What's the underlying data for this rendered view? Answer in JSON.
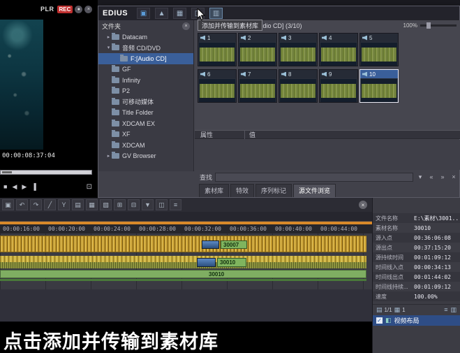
{
  "monitor": {
    "plr_label": "PLR",
    "rec_label": "REC",
    "timecode": "00:00:08:37:04",
    "buttons": [
      {
        "name": "monitor-menu-button",
        "glyph": "●"
      },
      {
        "name": "monitor-close-button",
        "glyph": "×"
      }
    ],
    "transport": [
      {
        "name": "stop-button",
        "glyph": "■"
      },
      {
        "name": "prev-frame-button",
        "glyph": "◀"
      },
      {
        "name": "play-button",
        "glyph": "▶"
      },
      {
        "name": "next-frame-button",
        "glyph": "▐"
      }
    ],
    "fullscreen_glyph": "⊡"
  },
  "browser": {
    "app_title": "EDIUS",
    "titlebar_icons": [
      {
        "name": "open-folder-icon",
        "glyph": "▣"
      },
      {
        "name": "up-folder-icon",
        "glyph": "▲"
      },
      {
        "name": "view-thumbnails-icon",
        "glyph": "▦"
      },
      {
        "name": "view-split-icon",
        "glyph": "◫"
      },
      {
        "name": "add-transfer-icon",
        "glyph": "▥"
      }
    ],
    "tooltip": "添加并传输到素材库",
    "folders_header": "文件夹",
    "folders_close_glyph": "×",
    "tree": [
      {
        "label": "Datacam",
        "expander": "▸"
      },
      {
        "label": "音频 CD/DVD",
        "expander": "▾"
      },
      {
        "label": "F:[Audio CD]",
        "expander": ""
      },
      {
        "label": "GF",
        "expander": ""
      },
      {
        "label": "Infinity",
        "expander": ""
      },
      {
        "label": "P2",
        "expander": ""
      },
      {
        "label": "可移动媒体",
        "expander": ""
      },
      {
        "label": "Title Folder",
        "expander": ""
      },
      {
        "label": "XDCAM EX",
        "expander": ""
      },
      {
        "label": "XF",
        "expander": ""
      },
      {
        "label": "XDCAM",
        "expander": ""
      },
      {
        "label": "GV Browser",
        "expander": "▸"
      }
    ],
    "clips_title": "F:[Audio CD]  (3/10)",
    "zoom_label": "100%",
    "clips": [
      {
        "num": "1"
      },
      {
        "num": "2"
      },
      {
        "num": "3"
      },
      {
        "num": "4"
      },
      {
        "num": "5"
      },
      {
        "num": "6"
      },
      {
        "num": "7"
      },
      {
        "num": "8"
      },
      {
        "num": "9"
      },
      {
        "num": "10"
      }
    ],
    "props_name_col": "属性",
    "props_value_col": "值",
    "search_label": "查找",
    "search_icons": [
      {
        "name": "search-dropdown-icon",
        "glyph": "▾"
      },
      {
        "name": "prev-result-icon",
        "glyph": "«"
      },
      {
        "name": "next-result-icon",
        "glyph": "»"
      },
      {
        "name": "close-search-icon",
        "glyph": "×"
      }
    ],
    "tabs": [
      {
        "label": "素材库"
      },
      {
        "label": "特效"
      },
      {
        "label": "序列标记"
      },
      {
        "label": "源文件浏览"
      }
    ]
  },
  "timeline": {
    "toolbar": [
      {
        "name": "panel-icon",
        "glyph": "▣"
      },
      {
        "name": "undo-icon",
        "glyph": "↶"
      },
      {
        "name": "redo-icon",
        "glyph": "↷"
      },
      {
        "name": "pencil-icon",
        "glyph": "╱"
      },
      {
        "name": "razor-icon",
        "glyph": "Y"
      },
      {
        "name": "mode-icon",
        "glyph": "▤"
      },
      {
        "name": "insert-icon",
        "glyph": "▦"
      },
      {
        "name": "overwrite-icon",
        "glyph": "▧"
      },
      {
        "name": "ripple-icon",
        "glyph": "⊞"
      },
      {
        "name": "trim-icon",
        "glyph": "⊟"
      },
      {
        "name": "marker-icon",
        "glyph": "▼"
      },
      {
        "name": "zoom-icon",
        "glyph": "◫"
      },
      {
        "name": "settings-icon",
        "glyph": "≡"
      }
    ],
    "close_glyph": "×",
    "ruler": [
      "00:00:16:00",
      "00:00:20:00",
      "00:00:24:00",
      "00:00:28:00",
      "00:00:32:00",
      "00:00:36:00",
      "00:00:40:00",
      "00:00:44:00"
    ],
    "clip_30007": "30007",
    "clip_30010_a": "30010",
    "clip_30010_b": "30010"
  },
  "info": {
    "rows": [
      {
        "label": "文件名称",
        "value": "E:\\素材\\3001..."
      },
      {
        "label": "素材名称",
        "value": "30010"
      },
      {
        "label": "源入点",
        "value": "00:36:06:08"
      },
      {
        "label": "源出点",
        "value": "00:37:15:20"
      },
      {
        "label": "源持续时间",
        "value": "00:01:09:12"
      },
      {
        "label": "时间线入点",
        "value": "00:00:34:13"
      },
      {
        "label": "时间线出点",
        "value": "00:01:44:02"
      },
      {
        "label": "时间线持续...",
        "value": "00:01:09:12"
      },
      {
        "label": "速度",
        "value": "100.00%"
      }
    ],
    "page_icon": "▤",
    "page_label": "1/1",
    "track_icon": "▦",
    "track_label": "1",
    "list_icon": "≡",
    "grid_icon": "▥",
    "check_glyph": "✓",
    "layout_icon": "◧",
    "layout_label": "视频布局"
  },
  "caption": "点击添加并传输到素材库"
}
